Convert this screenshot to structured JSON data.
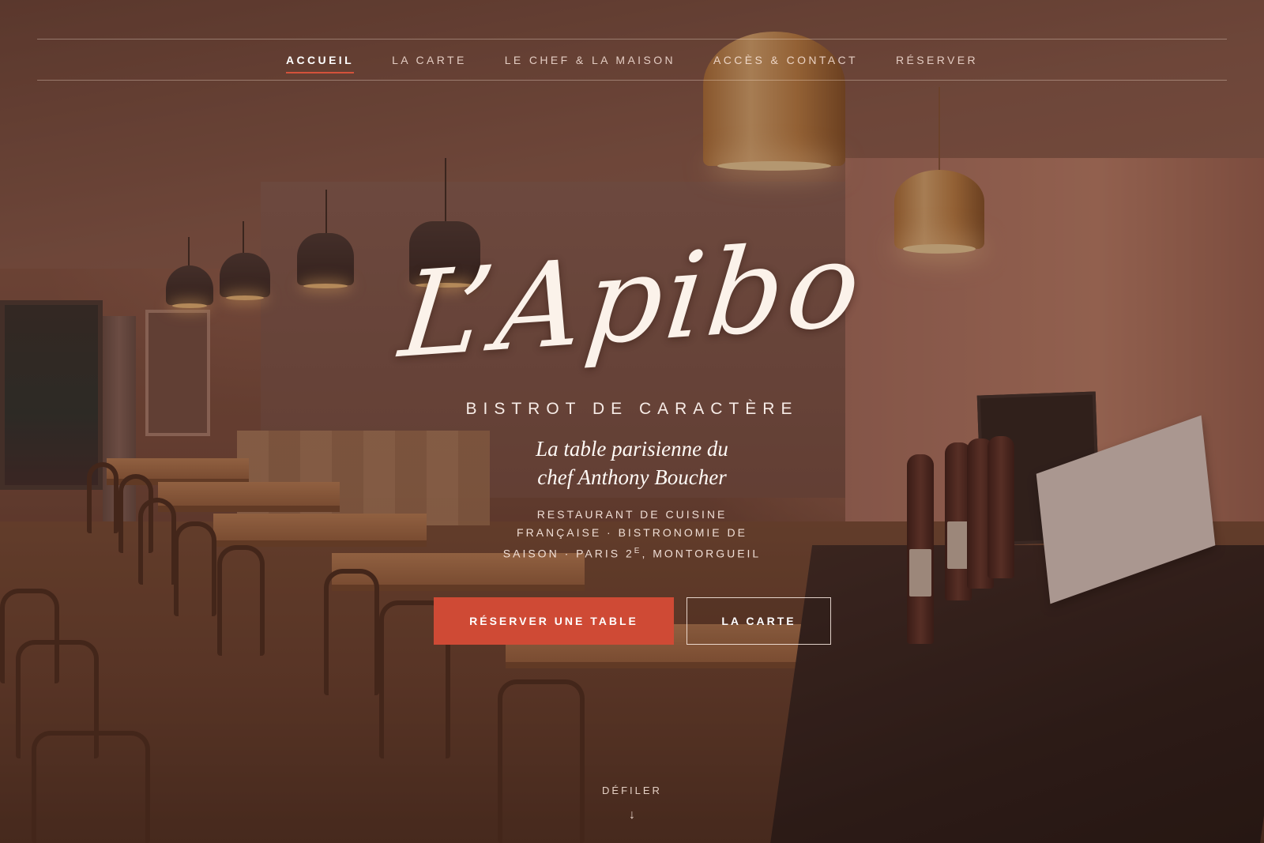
{
  "nav": {
    "items": [
      {
        "label": "ACCUEIL",
        "active": true
      },
      {
        "label": "LA CARTE",
        "active": false
      },
      {
        "label": "LE CHEF & LA MAISON",
        "active": false
      },
      {
        "label": "ACCÈS & CONTACT",
        "active": false
      },
      {
        "label": "RÉSERVER",
        "active": false
      }
    ]
  },
  "hero": {
    "logo": "L’Apibo",
    "tagline": "BISTROT DE CARACTÈRE",
    "subtitle_line1": "La table parisienne du",
    "subtitle_line2": "chef Anthony Boucher",
    "desc_line1": "RESTAURANT DE CUISINE",
    "desc_line2": "FRANÇAISE · BISTRONOMIE DE",
    "desc_line3_a": "SAISON · PARIS 2",
    "desc_line3_sup": "E",
    "desc_line3_b": ", MONTORGUEIL",
    "cta_primary": "RÉSERVER UNE TABLE",
    "cta_secondary": "LA CARTE",
    "scroll_label": "DÉFILER",
    "scroll_arrow": "↓"
  },
  "colors": {
    "accent": "#cf4a35",
    "active_underline": "#d4523a",
    "overlay": "#3a1e16"
  }
}
